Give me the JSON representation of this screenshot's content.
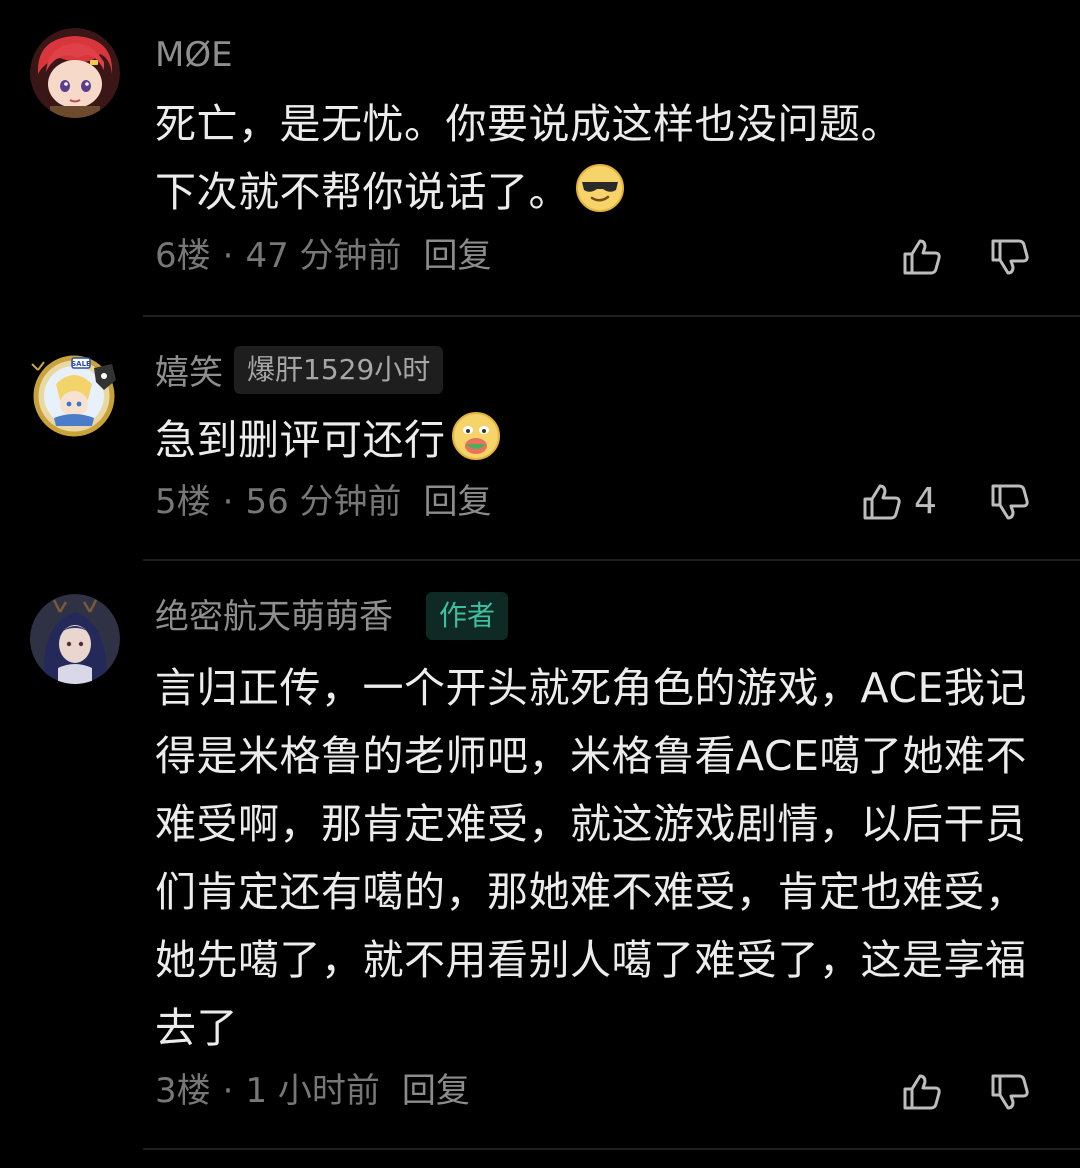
{
  "comments": [
    {
      "username": "MØE",
      "badge": null,
      "body": "死亡，是无忧。你要说成这样也没问题。\n下次就不帮你说话了。",
      "emoji": "cool-sunglasses-emoji",
      "floor": "6楼",
      "sep": "·",
      "time": "47 分钟前",
      "reply": "回复",
      "likes": ""
    },
    {
      "username": "嬉笑",
      "badge": "爆肝1529小时",
      "body": "急到删评可还行",
      "emoji": "chewing-face-emoji",
      "floor": "5楼",
      "sep": "·",
      "time": "56 分钟前",
      "reply": "回复",
      "likes": "4"
    },
    {
      "username": "绝密航天萌萌香",
      "badge": "作者",
      "body": "言归正传，一个开头就死角色的游戏，ACE我记得是米格鲁的老师吧，米格鲁看ACE噶了她难不难受啊，那肯定难受，就这游戏剧情，以后干员们肯定还有噶的，那她难不难受，肯定也难受，她先噶了，就不用看别人噶了难受了，这是享福去了",
      "emoji": null,
      "floor": "3楼",
      "sep": "·",
      "time": "1 小时前",
      "reply": "回复",
      "likes": ""
    }
  ],
  "icons": {
    "like": "thumbs-up-icon",
    "dislike": "thumbs-down-icon"
  },
  "colors": {
    "background": "#000000",
    "text": "#ECECEC",
    "muted": "#8E8E8E",
    "author_badge": "#3FBFA0"
  }
}
